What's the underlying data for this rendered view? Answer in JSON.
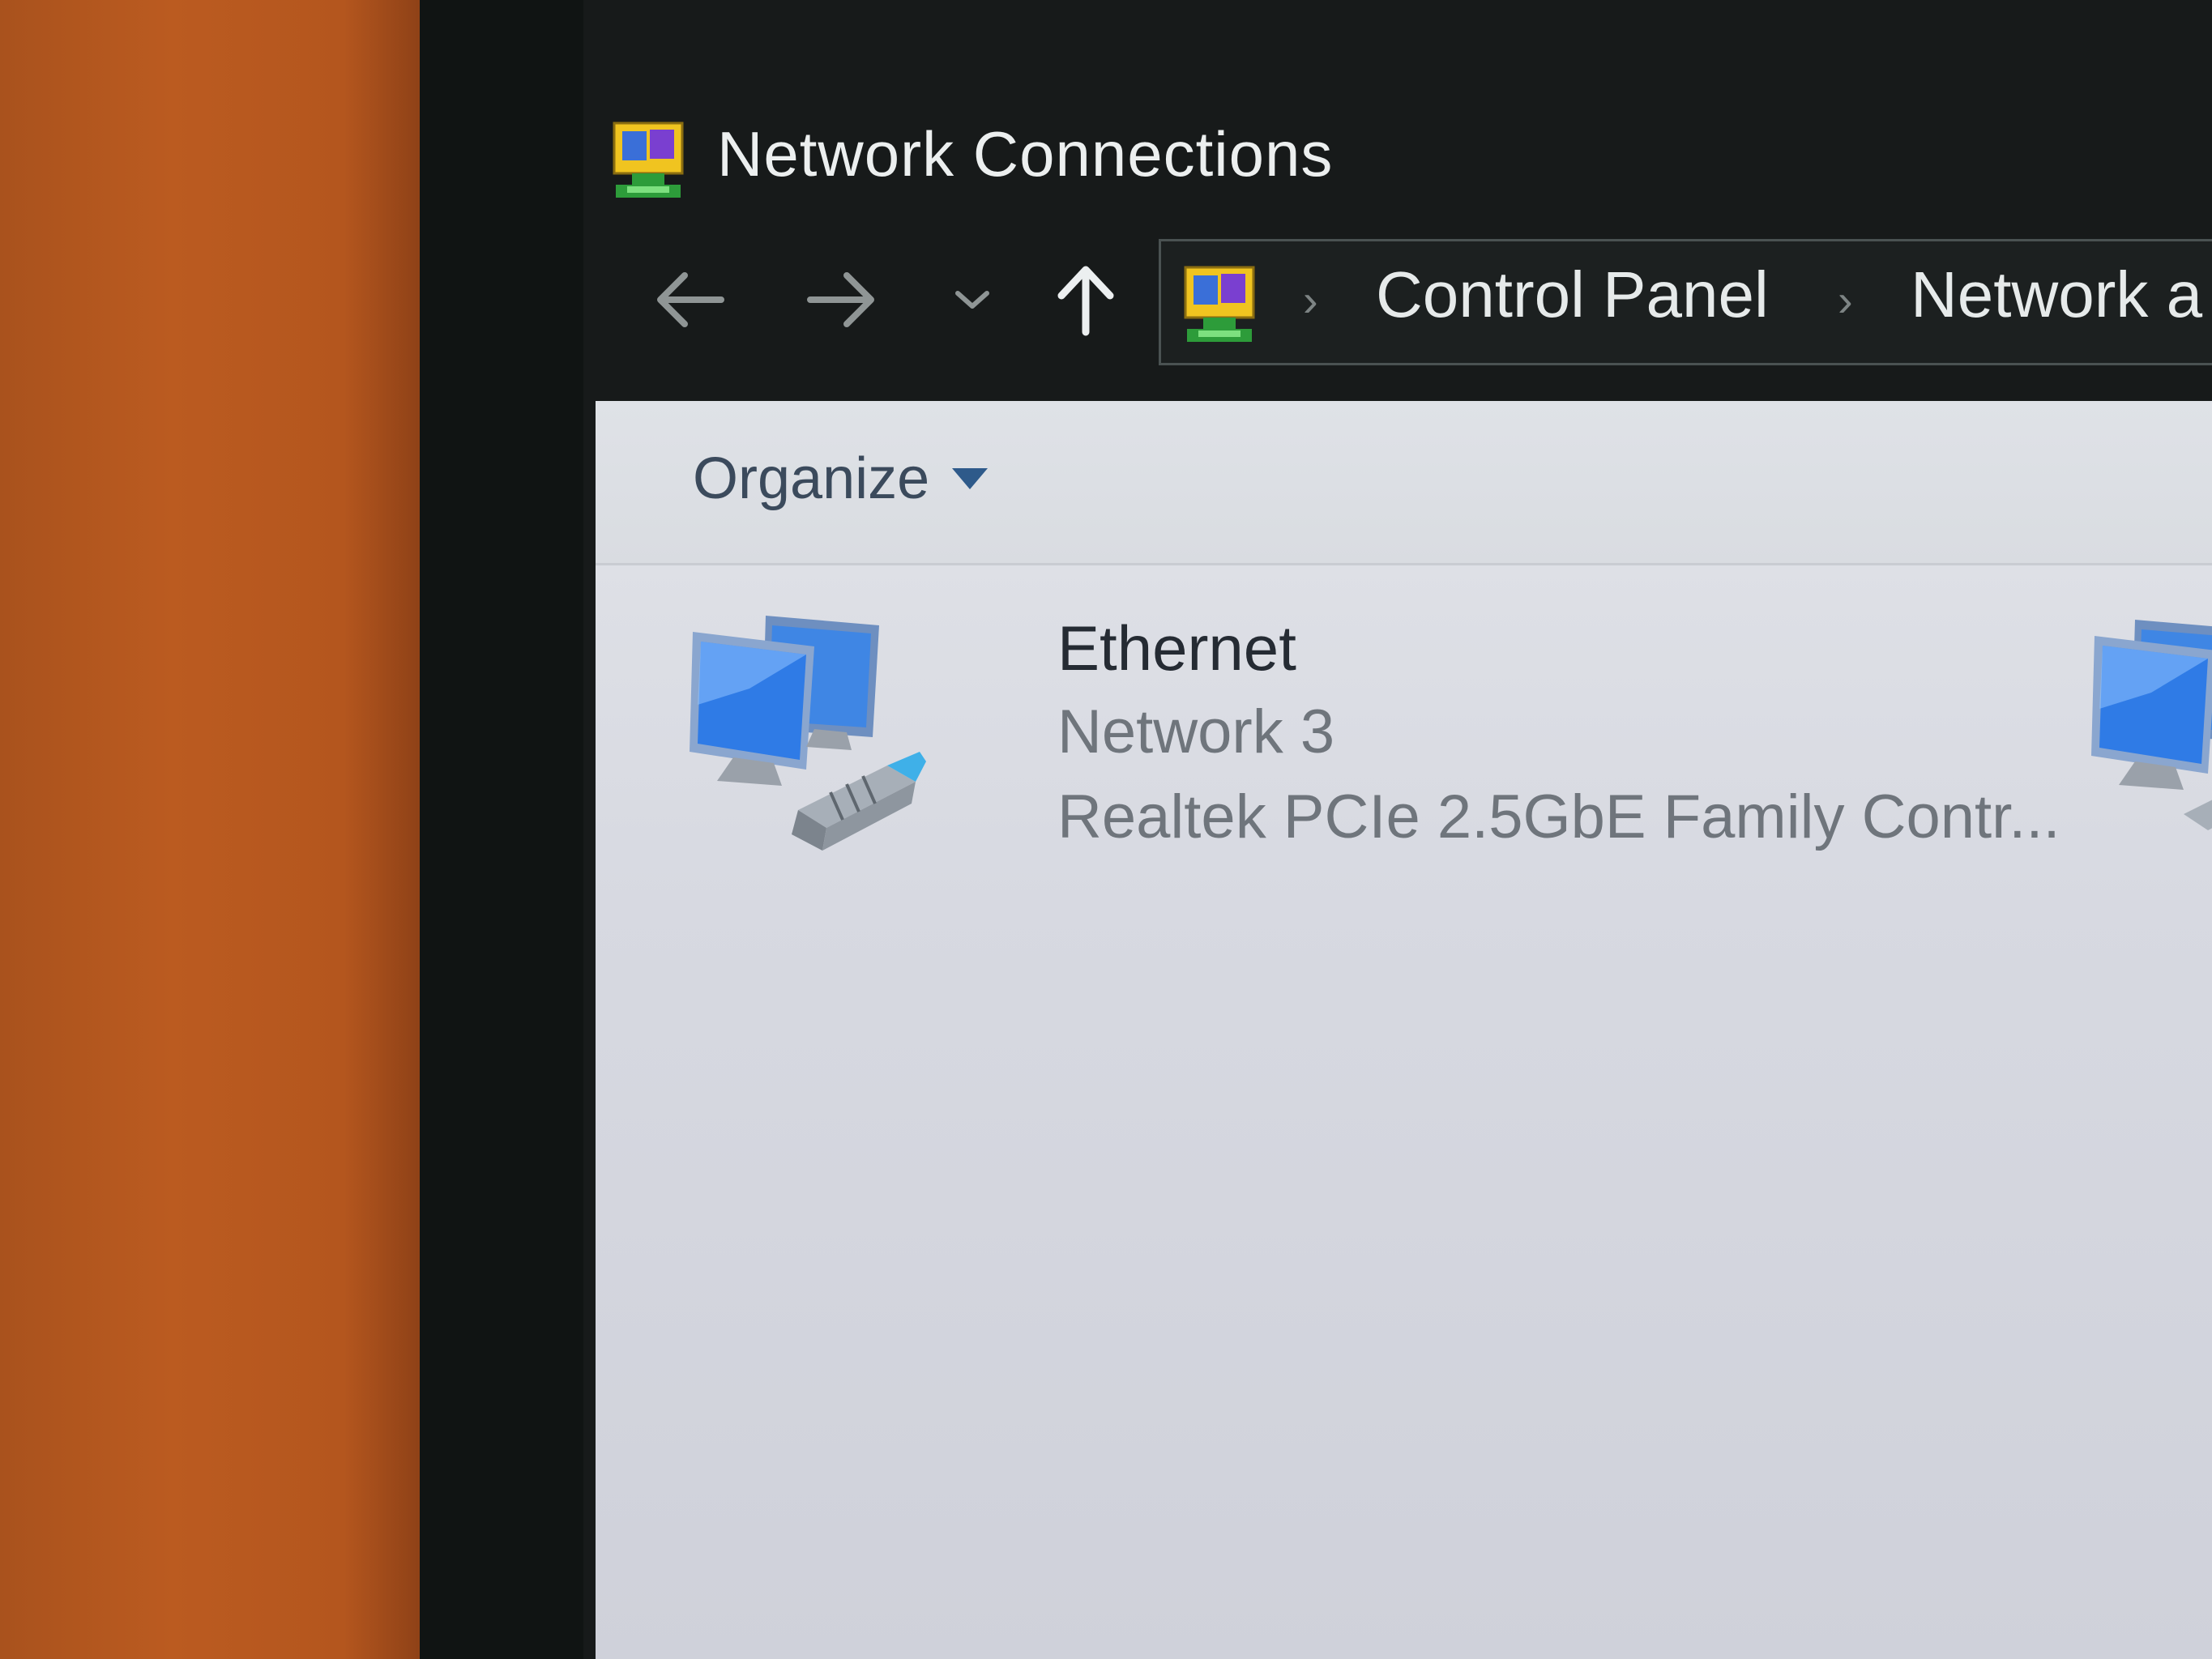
{
  "window": {
    "title": "Network Connections",
    "title_icon": "network-connections-icon"
  },
  "navigation": {
    "back_icon": "arrow-left-icon",
    "forward_icon": "arrow-right-icon",
    "recent_icon": "chevron-down-icon",
    "up_icon": "arrow-up-icon",
    "address": {
      "location_icon": "network-connections-icon",
      "breadcrumbs": [
        "Control Panel",
        "Network a"
      ]
    }
  },
  "toolbar": {
    "organize_label": "Organize"
  },
  "connections": [
    {
      "name": "Ethernet",
      "status": "Network 3",
      "device": "Realtek PCIe 2.5GbE Family Contr...",
      "icon": "ethernet-adapter-icon"
    }
  ],
  "colors": {
    "title_bar_bg": "#171a1a",
    "content_bg": "#d9dbe2",
    "accent_blue": "#2e6fd0"
  }
}
